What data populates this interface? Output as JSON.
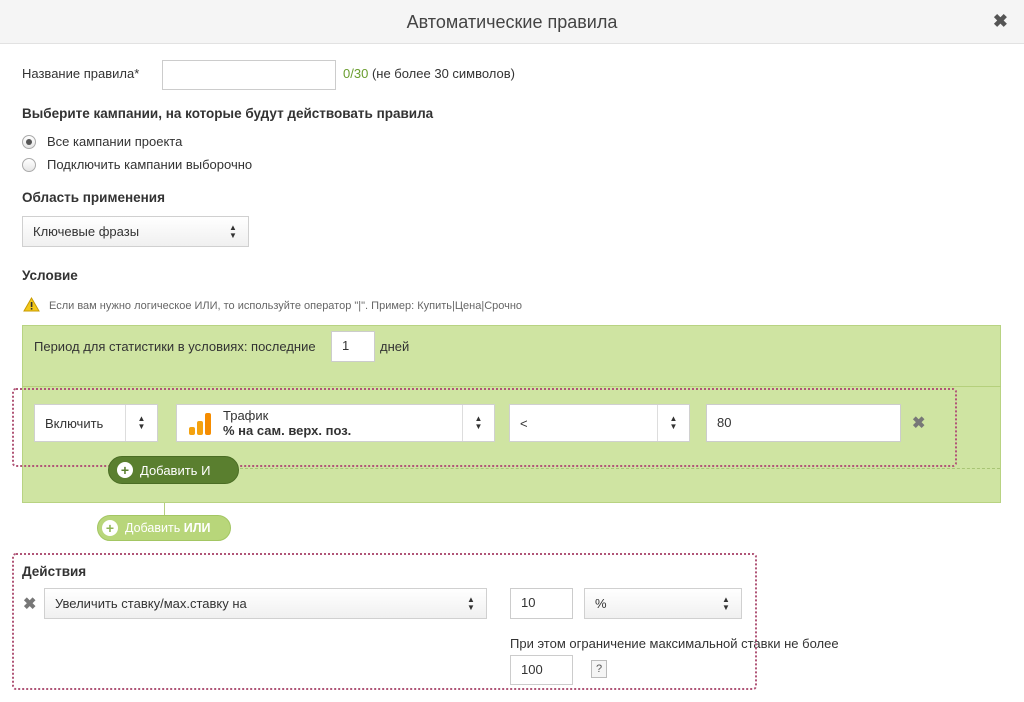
{
  "dialog": {
    "title": "Автоматические правила"
  },
  "rule_name": {
    "label": "Название правила*",
    "value": "",
    "counter": "0/30",
    "hint": "(не более 30 символов)"
  },
  "campaigns": {
    "heading": "Выберите кампании, на которые будут действовать правила",
    "options": [
      "Все кампании проекта",
      "Подключить кампании выборочно"
    ],
    "selected_index": 0
  },
  "scope": {
    "heading": "Область применения",
    "selected": "Ключевые фразы"
  },
  "condition": {
    "heading": "Условие",
    "warning": "Если вам нужно логическое ИЛИ, то используйте оператор \"|\". Пример: Купить|Цена|Срочно",
    "period_label": "Период для статистики в условиях: последние",
    "period_value": "1",
    "period_unit": "дней",
    "row": {
      "mode": "Включить",
      "metric_title": "Трафик",
      "metric_sub": "% на сам. верх. поз.",
      "operator": "<",
      "value": "80"
    },
    "add_and": "Добавить И",
    "add_or_prefix": "Добавить",
    "add_or_bold": "ИЛИ"
  },
  "actions": {
    "heading": "Действия",
    "action": "Увеличить ставку/мах.ставку на",
    "amount": "10",
    "unit": "%",
    "limit_label": "При этом ограничение максимальной ставки не более",
    "limit_value": "100",
    "help": "?"
  },
  "icons": {
    "close": "close-icon",
    "warning": "warning-icon",
    "analytics": "analytics-icon",
    "remove": "remove-icon",
    "plus": "plus-icon"
  },
  "colors": {
    "accent_green": "#6a9d2f",
    "condition_bg": "#cfe4a2",
    "button_dark": "#5a7f2f",
    "button_light": "#b8d67a",
    "highlight": "#b05577",
    "analytics_orange": "#f4a20f"
  }
}
